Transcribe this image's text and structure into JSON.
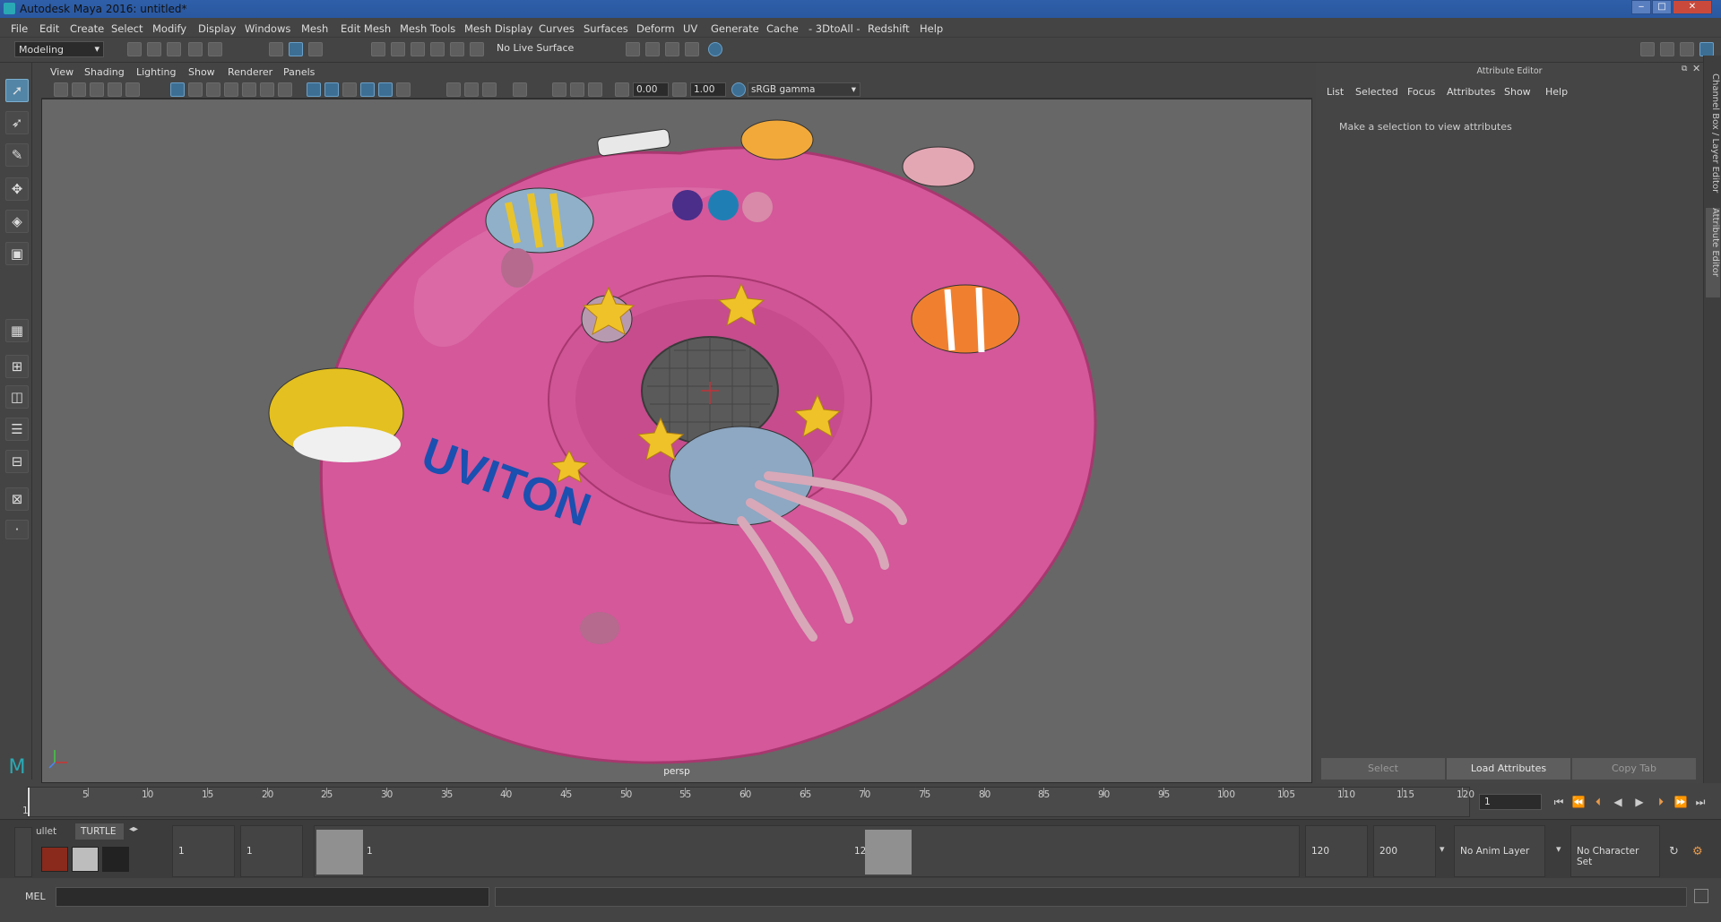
{
  "window": {
    "title": "Autodesk Maya 2016: untitled*",
    "controls": [
      "‒",
      "□",
      "✕"
    ]
  },
  "menu": [
    "File",
    "Edit",
    "Create",
    "Select",
    "Modify",
    "Display",
    "Windows",
    "Mesh",
    "Edit Mesh",
    "Mesh Tools",
    "Mesh Display",
    "Curves",
    "Surfaces",
    "Deform",
    "UV",
    "Generate",
    "Cache",
    "- 3DtoAll -",
    "Redshift",
    "Help"
  ],
  "shelf": {
    "mode": "Modeling",
    "live_surface": "No Live Surface"
  },
  "panel_menu": [
    "View",
    "Shading",
    "Lighting",
    "Show",
    "Renderer",
    "Panels"
  ],
  "viewport_toolbar": {
    "exposure": "0.00",
    "gamma": "1.00",
    "color_space": "sRGB gamma"
  },
  "viewport": {
    "camera_label": "persp",
    "model_brand_text": "UVITON"
  },
  "attribute_editor": {
    "header": "Attribute Editor",
    "menu": [
      "List",
      "Selected",
      "Focus",
      "Attributes",
      "Show",
      "Help"
    ],
    "message": "Make a selection to view attributes",
    "buttons": {
      "select": "Select",
      "load": "Load Attributes",
      "copy": "Copy Tab"
    }
  },
  "side_tabs": {
    "channel_box": "Channel Box / Layer Editor",
    "attribute_editor": "Attribute Editor"
  },
  "timeline": {
    "ticks": [
      "5",
      "10",
      "15",
      "20",
      "25",
      "30",
      "35",
      "40",
      "45",
      "50",
      "55",
      "60",
      "65",
      "70",
      "75",
      "80",
      "85",
      "90",
      "95",
      "100",
      "105",
      "110",
      "115",
      "120"
    ],
    "start_label": "1",
    "current_frame": "1"
  },
  "shelf_tabs": {
    "bullet": "ullet",
    "turtle": "TURTLE"
  },
  "range": {
    "start": "1",
    "anim_start": "1",
    "slider_start": "1",
    "slider_end": "120",
    "end": "120",
    "anim_end": "200",
    "anim_layer": "No Anim Layer",
    "character_set": "No Character Set"
  },
  "command_line": {
    "label": "MEL"
  },
  "colors": {
    "accent": "#5285a6",
    "float": "#d4589a",
    "viewport_bg": "#676767"
  }
}
